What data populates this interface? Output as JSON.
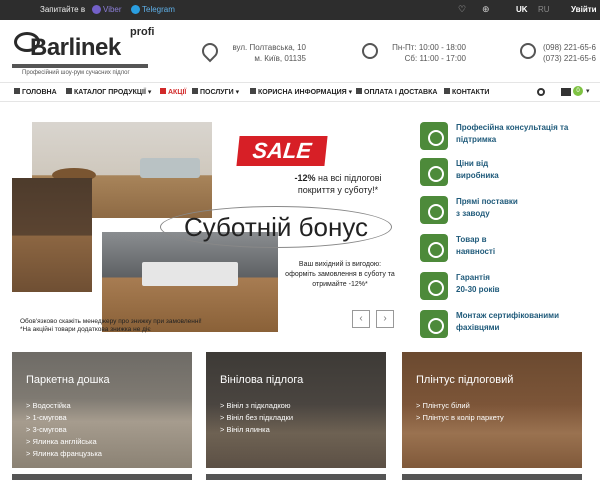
{
  "topbar": {
    "ask": "Запитайте в",
    "viber": "Viber",
    "telegram": "Telegram",
    "lang_uk": "UK",
    "lang_ru": "RU",
    "login": "Увійти"
  },
  "header": {
    "brand": "Barlinek",
    "brand_suffix": "profi",
    "tagline": "Професійний шоу-рум сучасних підлог",
    "address_line1": "вул. Полтавська, 10",
    "address_line2": "м. Київ, 01135",
    "hours_line1": "Пн-Пт: 10:00 - 18:00",
    "hours_line2": "Сб: 11:00 - 17:00",
    "phone1": "(098) 221-65-6",
    "phone2": "(073) 221-65-6"
  },
  "nav": {
    "items": [
      {
        "label": "ГОЛОВНА"
      },
      {
        "label": "КАТАЛОГ ПРОДУКЦІЇ ▾"
      },
      {
        "label": "АКЦІЇ"
      },
      {
        "label": "ПОСЛУГИ ▾"
      },
      {
        "label": "КОРИСНА ИНФОРМАЦИЯ ▾"
      },
      {
        "label": "ОПЛАТА І ДОСТАВКА"
      },
      {
        "label": "КОНТАКТИ"
      }
    ],
    "cart_count": "0",
    "cart_caret": "▾"
  },
  "hero": {
    "sale": "SALE",
    "promo1_bold": "-12%",
    "promo1_rest": "на всі підлогові покриття у суботу!*",
    "bonus_title": "Суботній бонус",
    "promo2": "Ваш вихідний із вигодою: оформіть замовлення в суботу та отримайте -12%*",
    "disclaimer1": "Обов'язково скажіть менеджеру про знижку при замовленні!",
    "disclaimer2": "*На акційні товари додаткова знижка не діє",
    "prev": "‹",
    "next": "›"
  },
  "features": [
    {
      "line1": "Професійна консультація та",
      "line2": "підтримка"
    },
    {
      "line1": "Ціни від",
      "line2": "виробника"
    },
    {
      "line1": "Прямі поставки",
      "line2": "з заводу"
    },
    {
      "line1": "Товар в",
      "line2": "наявності"
    },
    {
      "line1": "Гарантія",
      "line2": "20-30 років"
    },
    {
      "line1": "Монтаж сертифікованими",
      "line2": "фахівцями"
    }
  ],
  "categories": [
    {
      "title": "Паркетна дошка",
      "items": [
        "> Водостійка",
        "> 1-смугова",
        "> 3-смугова",
        "> Ялинка англійська",
        "> Ялинка французька"
      ]
    },
    {
      "title": "Вінілова підлога",
      "items": [
        "> Вініл з підкладкою",
        "> Вініл без підкладки",
        "> Вініл ялинка"
      ]
    },
    {
      "title": "Плінтус підлоговий",
      "items": [
        "> Плінтус білий",
        "> Плінтус в колір паркету"
      ]
    }
  ],
  "colors": {
    "accent_green": "#4d8a3a",
    "feature_text": "#1f5a7a",
    "sale_red": "#d71f26",
    "topbar_bg": "#2d2d2d"
  }
}
